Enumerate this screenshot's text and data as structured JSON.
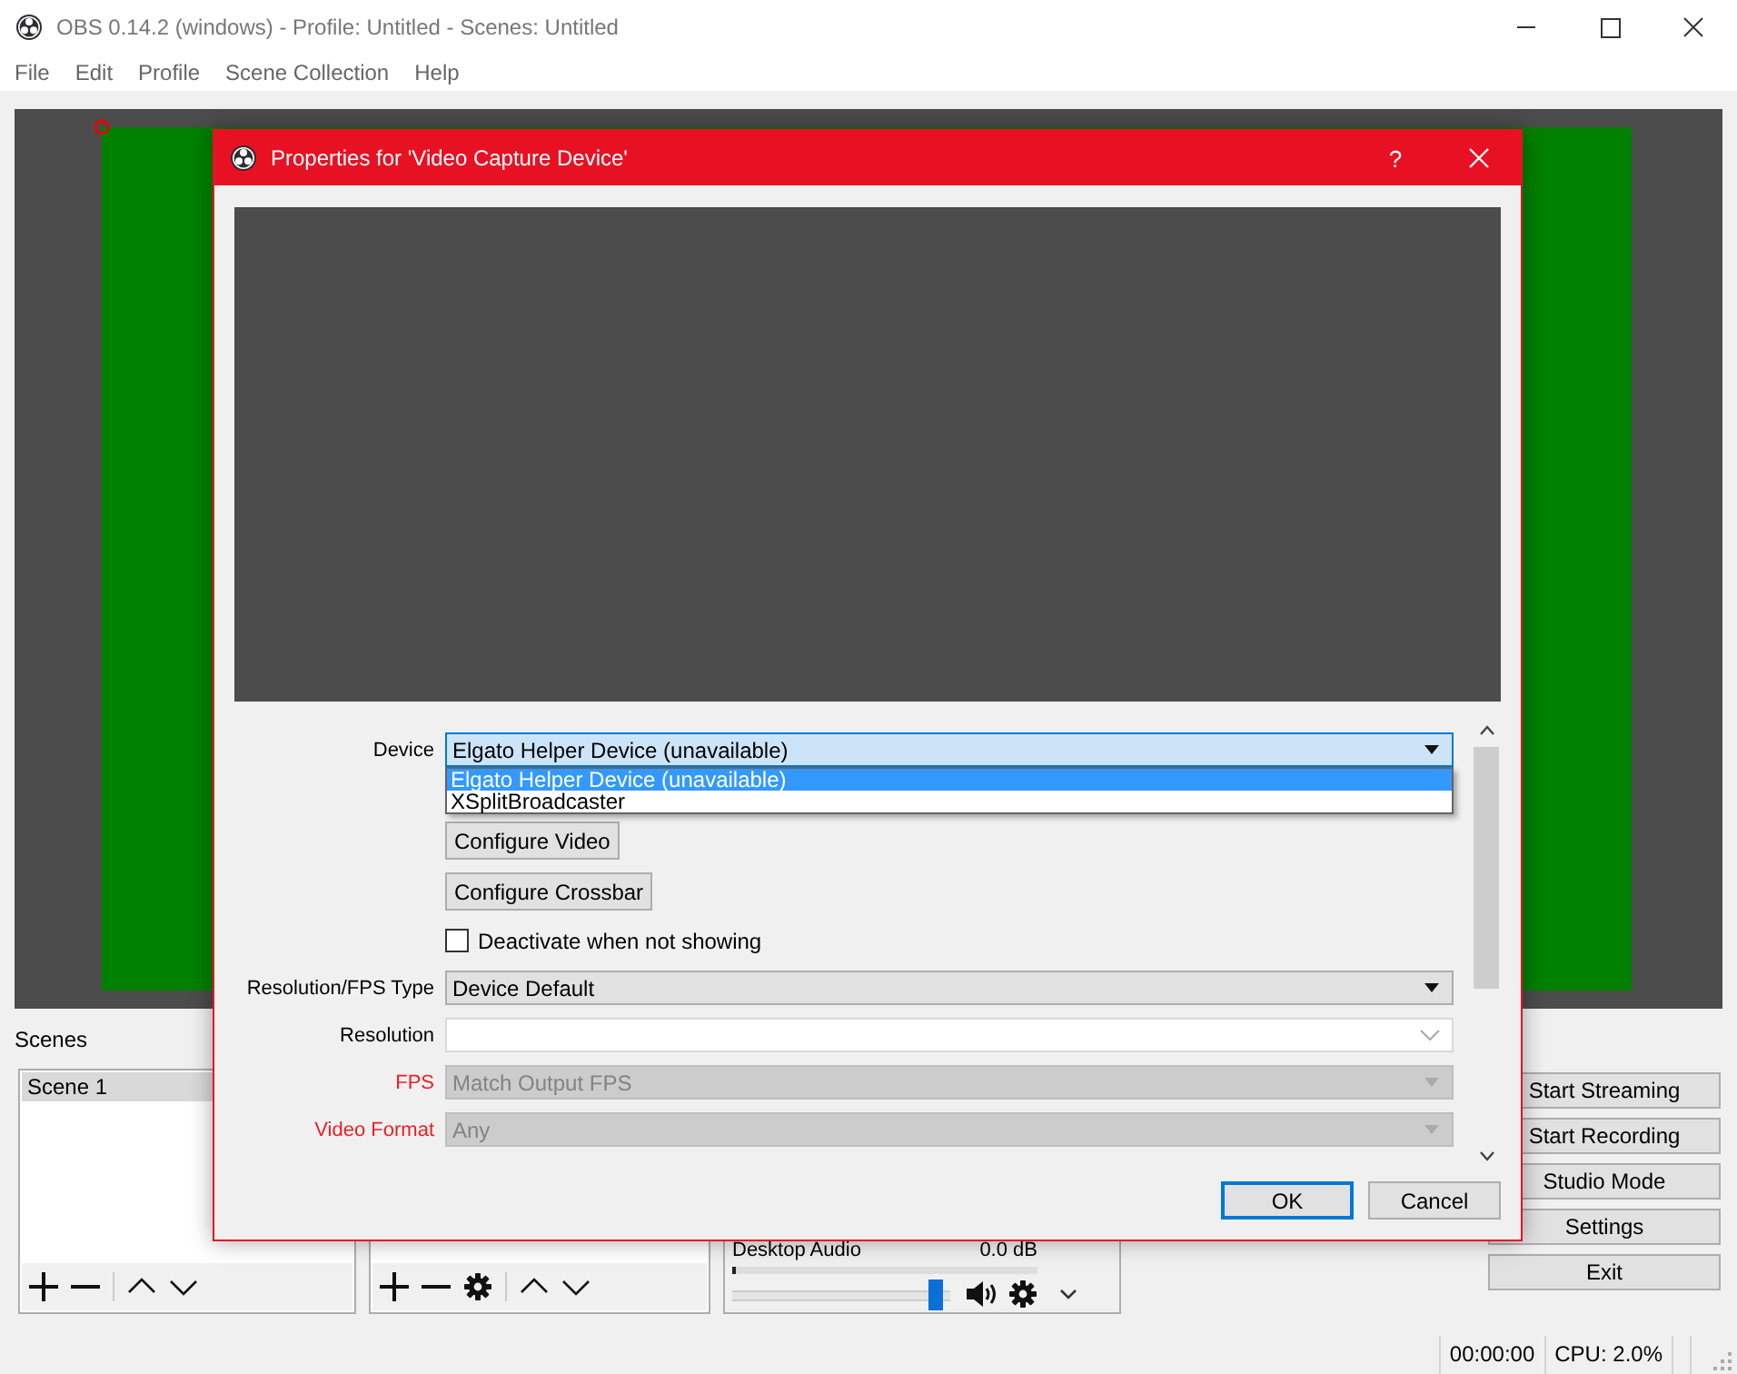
{
  "window": {
    "title": "OBS 0.14.2 (windows) - Profile: Untitled - Scenes: Untitled"
  },
  "menu": [
    {
      "label": "File"
    },
    {
      "label": "Edit"
    },
    {
      "label": "Profile"
    },
    {
      "label": "Scene Collection"
    },
    {
      "label": "Help"
    }
  ],
  "scenes": {
    "title": "Scenes",
    "items": [
      {
        "label": "Scene 1",
        "selected": true
      }
    ]
  },
  "mixer": {
    "channels": [
      {
        "name": "Desktop Audio",
        "reading": "0.0 dB",
        "level": 0.97
      }
    ]
  },
  "controls": [
    "Start Streaming",
    "Start Recording",
    "Studio Mode",
    "Settings",
    "Exit"
  ],
  "status_bar": {
    "time": "00:00:00",
    "cpu": "CPU: 2.0%"
  },
  "dialog": {
    "title": "Properties for 'Video Capture Device'",
    "help": "?",
    "rows": [
      {
        "kind": "dropdown",
        "label": "Device",
        "value": "Elgato Helper Device (unavailable)",
        "open": true,
        "disabled": false,
        "invalid": false,
        "options": [
          {
            "label": "Elgato Helper Device (unavailable)",
            "selected": true
          },
          {
            "label": "XSplitBroadcaster",
            "selected": false
          }
        ]
      },
      {
        "kind": "button",
        "label": "Configure Video"
      },
      {
        "kind": "button",
        "label": "Configure Crossbar"
      },
      {
        "kind": "checkbox",
        "label": "Deactivate when not showing",
        "checked": false
      },
      {
        "kind": "dropdown",
        "label": "Resolution/FPS Type",
        "value": "Device Default",
        "open": false,
        "disabled": false,
        "invalid": false
      },
      {
        "kind": "combo",
        "label": "Resolution",
        "disabled": false,
        "invalid": false
      },
      {
        "kind": "dropdown",
        "label": "FPS",
        "value": "Match Output FPS",
        "open": false,
        "disabled": true,
        "invalid": true
      },
      {
        "kind": "dropdown",
        "label": "Video Format",
        "value": "Any",
        "open": false,
        "disabled": true,
        "invalid": true
      }
    ],
    "buttons": [
      {
        "label": "OK",
        "default": true
      },
      {
        "label": "Cancel",
        "default": false
      }
    ]
  }
}
